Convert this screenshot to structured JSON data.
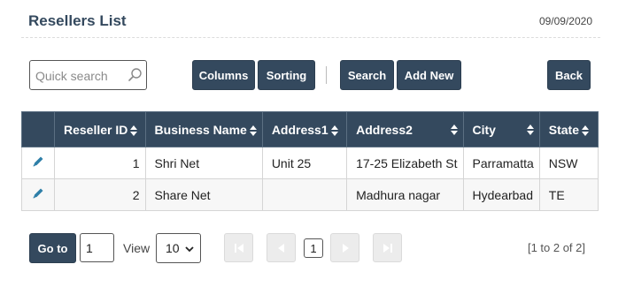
{
  "header": {
    "title": "Resellers List",
    "date": "09/09/2020"
  },
  "toolbar": {
    "search_placeholder": "Quick search",
    "columns_label": "Columns",
    "sorting_label": "Sorting",
    "search_label": "Search",
    "add_new_label": "Add New",
    "back_label": "Back"
  },
  "table": {
    "columns": [
      "Reseller ID",
      "Business Name",
      "Address1",
      "Address2",
      "City",
      "State"
    ],
    "rows": [
      {
        "id": "1",
        "business_name": "Shri Net",
        "address1": "Unit 25",
        "address2": "17-25 Elizabeth St",
        "city": "Parramatta",
        "state": "NSW"
      },
      {
        "id": "2",
        "business_name": "Share Net",
        "address1": "",
        "address2": "Madhura nagar",
        "city": "Hydearbad",
        "state": "TE"
      }
    ]
  },
  "pagination": {
    "goto_label": "Go to",
    "goto_value": "1",
    "view_label": "View",
    "page_size": "10",
    "current_page": "1",
    "range_text": "[1 to 2 of 2]"
  },
  "colors": {
    "primary": "#34495e",
    "edit_icon": "#2e7fa8"
  }
}
